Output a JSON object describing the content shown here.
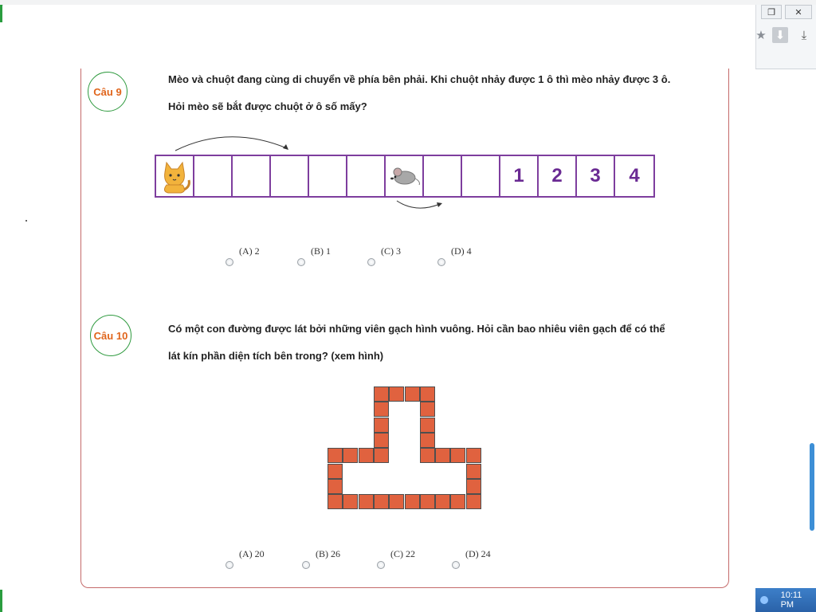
{
  "window": {
    "restore_glyph": "❐",
    "close_glyph": "✕",
    "favorite_icon": "star-icon",
    "download_icon": "download-icon",
    "favorite_glyph": "★",
    "download_glyph": "⤓"
  },
  "taskbar": {
    "clock": "10:11 PM"
  },
  "colors": {
    "accent_orange": "#e0651c",
    "ring_green": "#2f9a3f",
    "grid_purple": "#7e3e9e",
    "brick": "#e0623f"
  },
  "question9": {
    "badge": "Câu 9",
    "line1": "Mèo và chuột đang cùng di chuyển về phía bên phải. Khi chuột nhảy được 1 ô thì mèo nhảy được 3 ô.",
    "line2": "Hỏi mèo sẽ bắt được chuột ở ô số mấy?",
    "cells": [
      "cat",
      "",
      "",
      "",
      "",
      "",
      "mouse",
      "",
      "",
      "1",
      "2",
      "3",
      "4"
    ],
    "options": [
      {
        "label": "(A) 2"
      },
      {
        "label": "(B) 1"
      },
      {
        "label": "(C) 3"
      },
      {
        "label": "(D) 4"
      }
    ]
  },
  "question10": {
    "badge": "Câu 10",
    "line1": "Có một con đường được lát bởi những viên gạch hình vuông. Hỏi cần bao nhiêu viên gạch để có thể",
    "line2": "lát kín phần diện tích bên trong? (xem hình)",
    "options": [
      {
        "label": "(A) 20"
      },
      {
        "label": "(B) 26"
      },
      {
        "label": "(C) 22"
      },
      {
        "label": "(D) 24"
      }
    ]
  }
}
